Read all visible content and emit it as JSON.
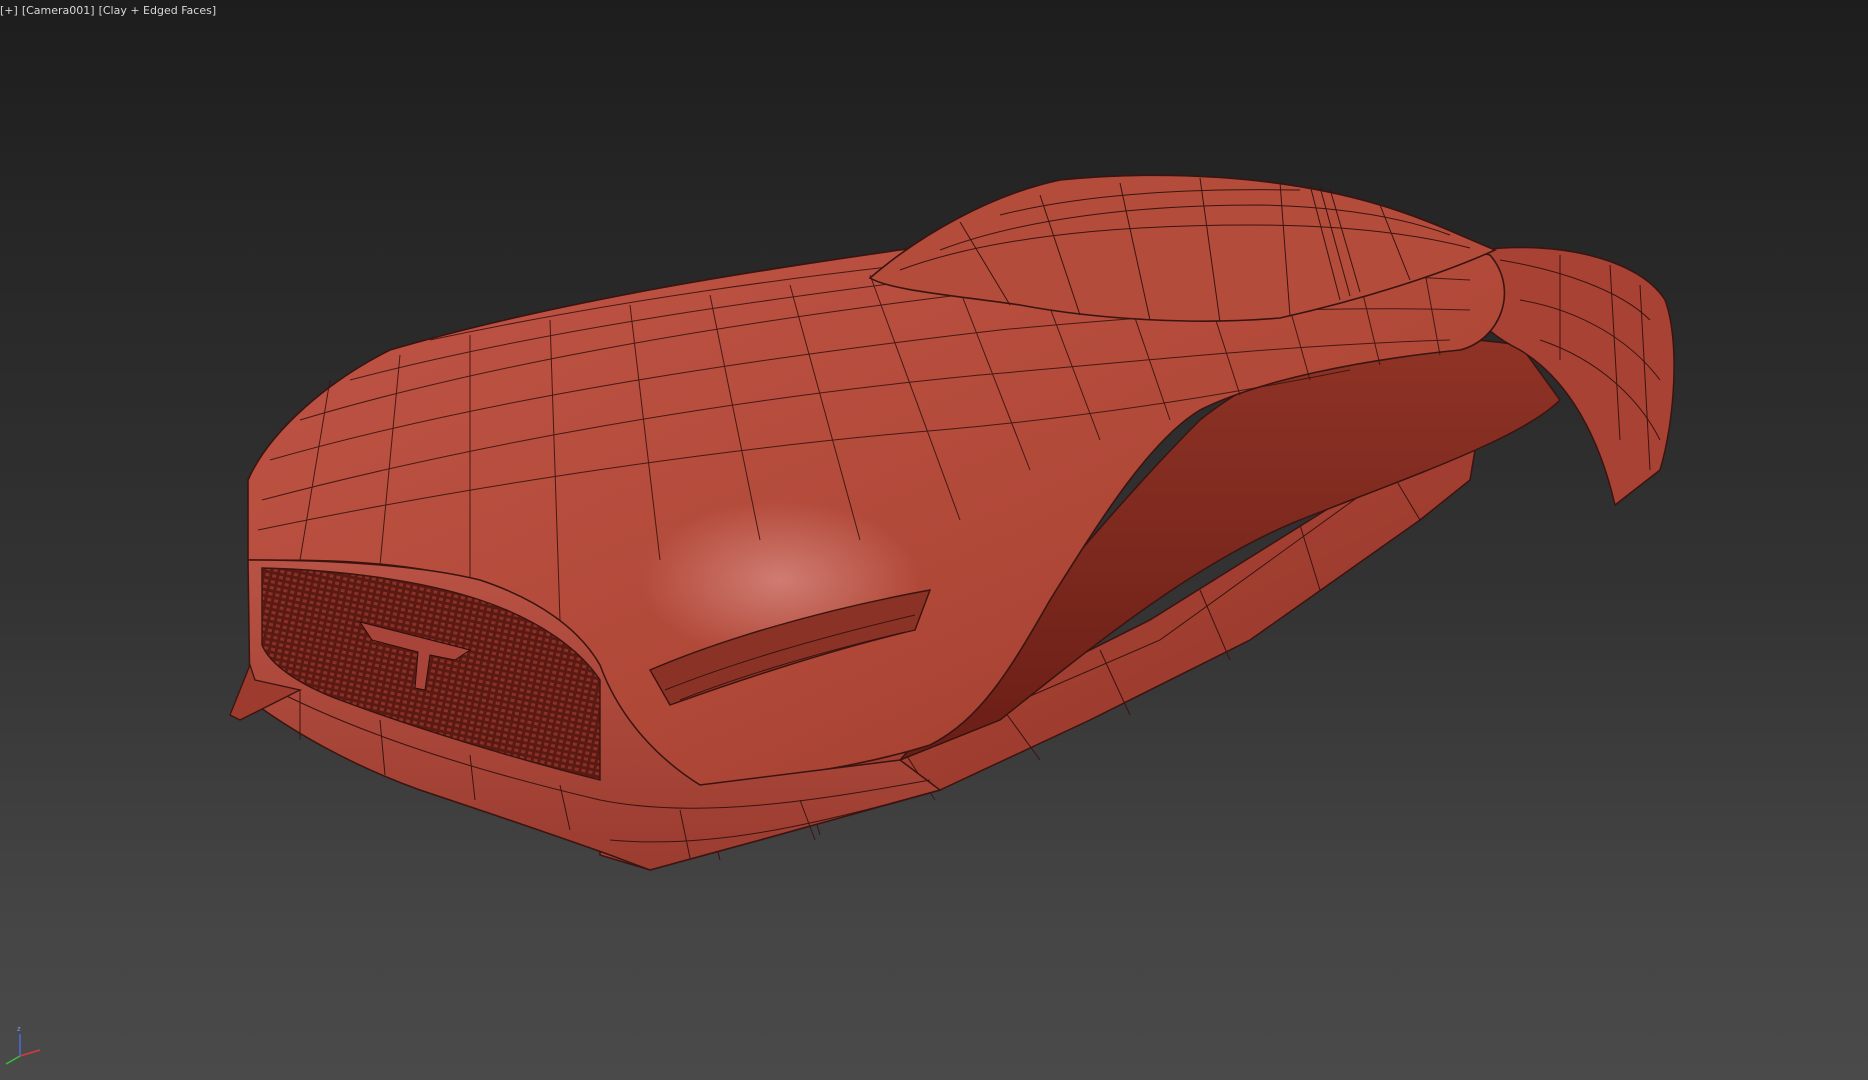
{
  "viewport": {
    "labels": [
      "[+]",
      "[Camera001]",
      "[Clay + Edged Faces]"
    ]
  },
  "scene": {
    "object": "car-body-mesh",
    "shading": "clay-edged-faces",
    "colors": {
      "clay": "#b24a3c",
      "clay_light": "#c65a4a",
      "clay_dark": "#7a2a22",
      "edge": "#3a1410",
      "background_top": "#1d1d1d",
      "background_bottom": "#4a4a4a"
    }
  },
  "gizmo": {
    "axes": [
      "x",
      "y",
      "z"
    ],
    "colors": {
      "x": "#d83a3a",
      "y": "#3ac03a",
      "z": "#4a6ad8"
    },
    "z_label": "z"
  }
}
